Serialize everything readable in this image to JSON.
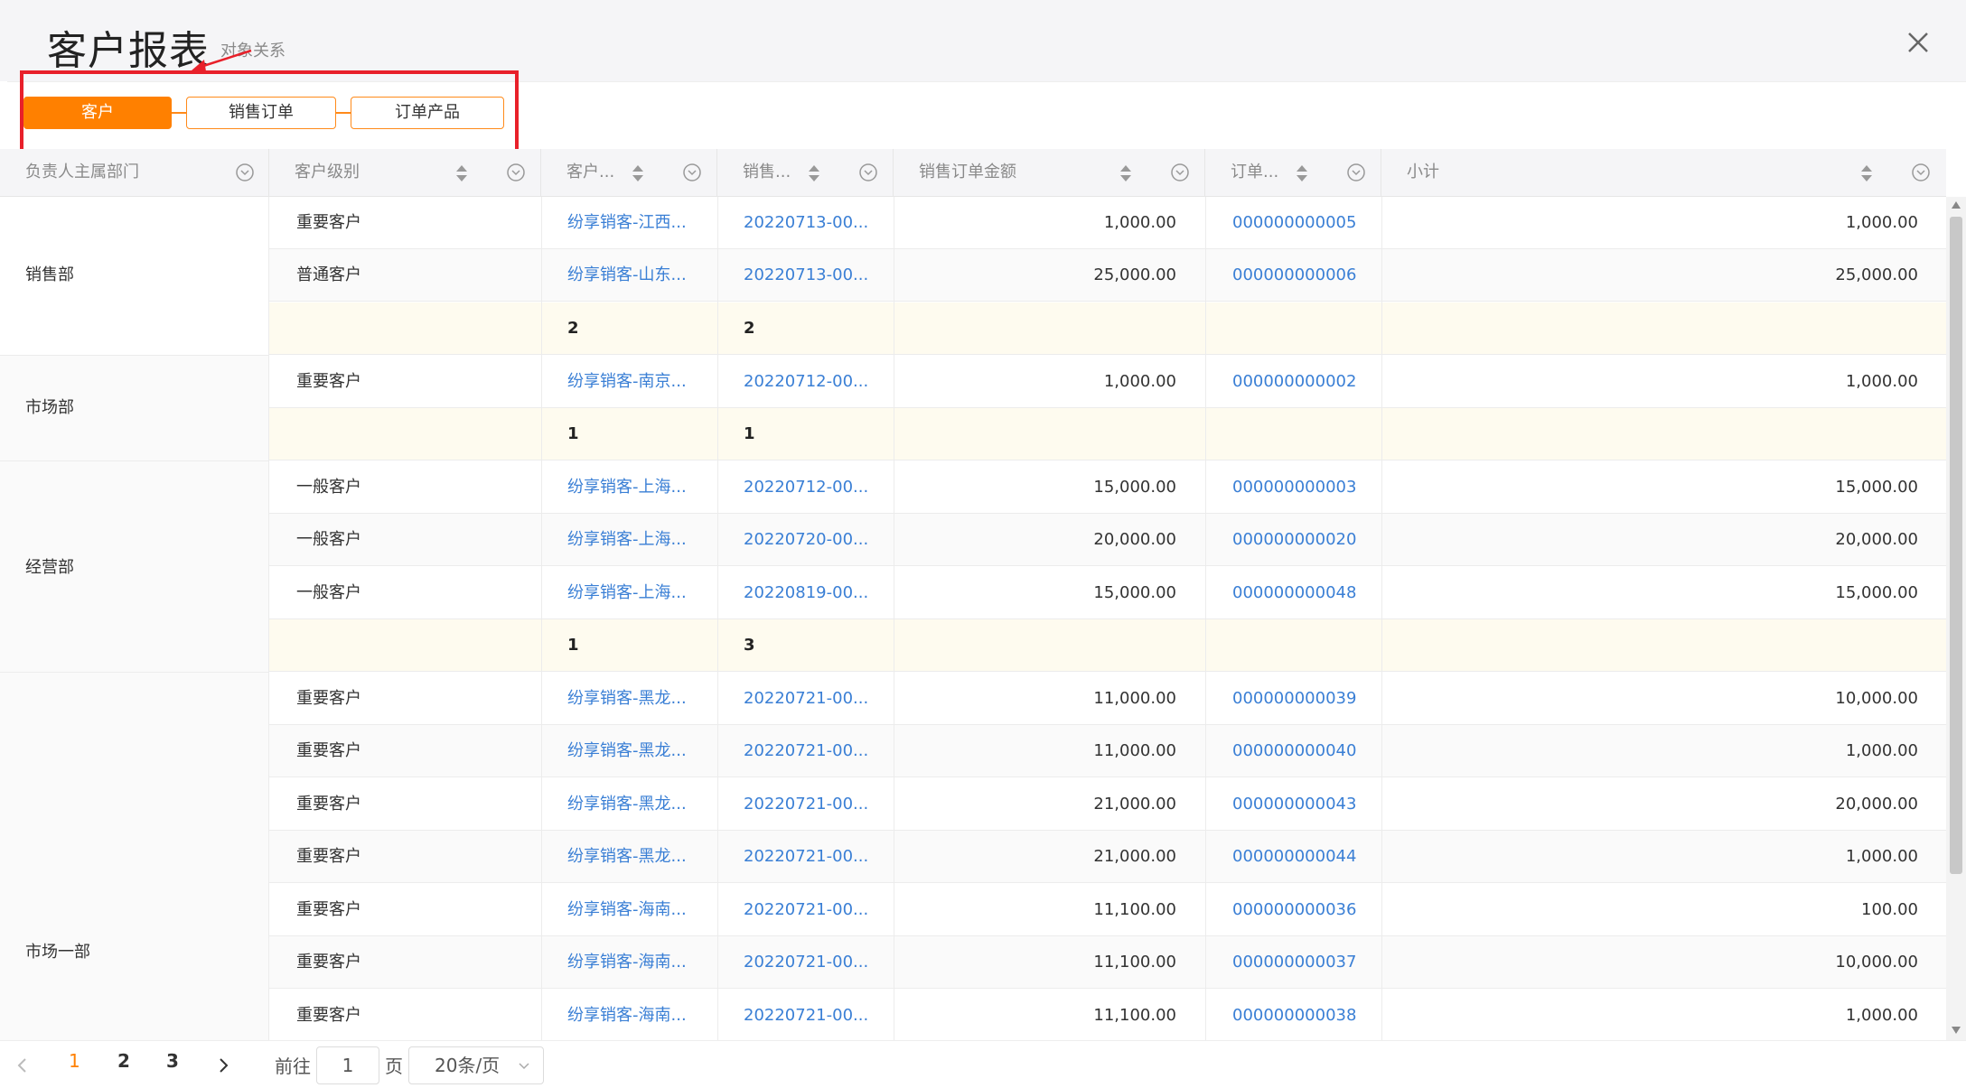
{
  "header": {
    "title": "客户报表",
    "annotation": "对象关系"
  },
  "steps": [
    {
      "label": "客户",
      "active": true
    },
    {
      "label": "销售订单",
      "active": false
    },
    {
      "label": "订单产品",
      "active": false
    }
  ],
  "columns": [
    {
      "label": "负责人主属部门"
    },
    {
      "label": "客户级别"
    },
    {
      "label": "客户..."
    },
    {
      "label": "销售..."
    },
    {
      "label": "销售订单金额"
    },
    {
      "label": "订单..."
    },
    {
      "label": "小计"
    }
  ],
  "groups": [
    {
      "name": "销售部"
    },
    {
      "name": "市场部"
    },
    {
      "name": "经营部"
    },
    {
      "name": "市场一部"
    }
  ],
  "rows": [
    {
      "level": "重要客户",
      "customer": "纷享销客-江西...",
      "order": "20220713-00...",
      "amount": "1,000.00",
      "order_no": "000000000005",
      "subtotal": "1,000.00"
    },
    {
      "level": "普通客户",
      "customer": "纷享销客-山东...",
      "order": "20220713-00...",
      "amount": "25,000.00",
      "order_no": "000000000006",
      "subtotal": "25,000.00"
    },
    {
      "sub_customer": "2",
      "sub_order": "2"
    },
    {
      "level": "重要客户",
      "customer": "纷享销客-南京...",
      "order": "20220712-00...",
      "amount": "1,000.00",
      "order_no": "000000000002",
      "subtotal": "1,000.00"
    },
    {
      "sub_customer": "1",
      "sub_order": "1"
    },
    {
      "level": "一般客户",
      "customer": "纷享销客-上海...",
      "order": "20220712-00...",
      "amount": "15,000.00",
      "order_no": "000000000003",
      "subtotal": "15,000.00"
    },
    {
      "level": "一般客户",
      "customer": "纷享销客-上海...",
      "order": "20220720-00...",
      "amount": "20,000.00",
      "order_no": "000000000020",
      "subtotal": "20,000.00"
    },
    {
      "level": "一般客户",
      "customer": "纷享销客-上海...",
      "order": "20220819-00...",
      "amount": "15,000.00",
      "order_no": "000000000048",
      "subtotal": "15,000.00"
    },
    {
      "sub_customer": "1",
      "sub_order": "3"
    },
    {
      "level": "重要客户",
      "customer": "纷享销客-黑龙...",
      "order": "20220721-00...",
      "amount": "11,000.00",
      "order_no": "000000000039",
      "subtotal": "10,000.00"
    },
    {
      "level": "重要客户",
      "customer": "纷享销客-黑龙...",
      "order": "20220721-00...",
      "amount": "11,000.00",
      "order_no": "000000000040",
      "subtotal": "1,000.00"
    },
    {
      "level": "重要客户",
      "customer": "纷享销客-黑龙...",
      "order": "20220721-00...",
      "amount": "21,000.00",
      "order_no": "000000000043",
      "subtotal": "20,000.00"
    },
    {
      "level": "重要客户",
      "customer": "纷享销客-黑龙...",
      "order": "20220721-00...",
      "amount": "21,000.00",
      "order_no": "000000000044",
      "subtotal": "1,000.00"
    },
    {
      "level": "重要客户",
      "customer": "纷享销客-海南...",
      "order": "20220721-00...",
      "amount": "11,100.00",
      "order_no": "000000000036",
      "subtotal": "100.00"
    },
    {
      "level": "重要客户",
      "customer": "纷享销客-海南...",
      "order": "20220721-00...",
      "amount": "11,100.00",
      "order_no": "000000000037",
      "subtotal": "10,000.00"
    },
    {
      "level": "重要客户",
      "customer": "纷享销客-海南...",
      "order": "20220721-00...",
      "amount": "11,100.00",
      "order_no": "000000000038",
      "subtotal": "1,000.00"
    }
  ],
  "pagination": {
    "pages": [
      "1",
      "2",
      "3"
    ],
    "current": "1",
    "goto_label": "前往",
    "goto_value": "1",
    "page_label": "页",
    "page_size": "20条/页"
  },
  "colors": {
    "accent": "#ff8000",
    "link": "#3a7fd5",
    "highlight": "#e8202a",
    "subtotal_bg": "#fefbef"
  }
}
